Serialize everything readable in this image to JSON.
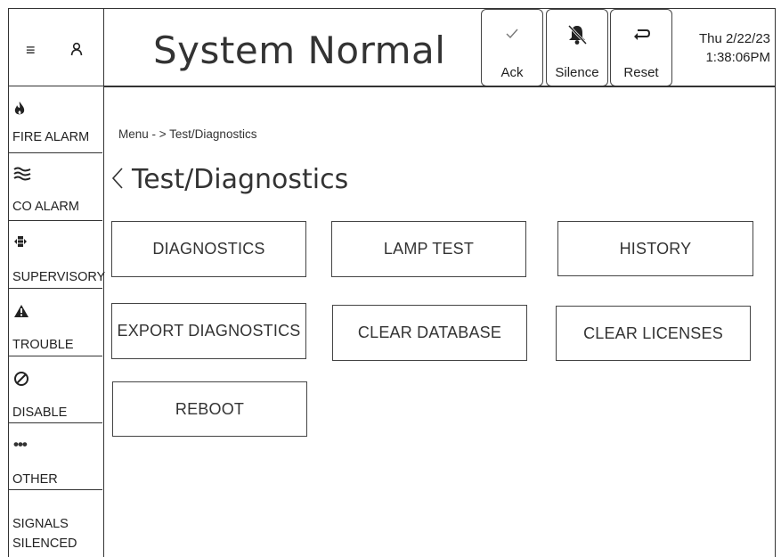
{
  "header": {
    "menu_icon": "hamburger-icon",
    "user_icon": "user-icon",
    "title": "System Normal",
    "buttons": [
      {
        "label": "Ack",
        "icon": "check-icon"
      },
      {
        "label": "Silence",
        "icon": "bell-muted-icon"
      },
      {
        "label": "Reset",
        "icon": "reset-arrow-icon"
      }
    ],
    "date": "Thu 2/22/23",
    "time": "1:38:06PM"
  },
  "sidebar": {
    "items": [
      {
        "label": "FIRE ALARM",
        "icon": "flame-icon"
      },
      {
        "label": "CO ALARM",
        "icon": "waves-icon"
      },
      {
        "label": "SUPERVISORY",
        "icon": "supervisory-icon"
      },
      {
        "label": "TROUBLE",
        "icon": "warning-icon"
      },
      {
        "label": "DISABLE",
        "icon": "prohibited-icon"
      },
      {
        "label": "OTHER",
        "icon": "more-icon"
      },
      {
        "label": "SIGNALS SILENCED"
      }
    ]
  },
  "main": {
    "breadcrumb": "Menu  - > Test/Diagnostics",
    "back_glyph": "〈",
    "page_title": "Test/Diagnostics",
    "tiles": [
      "DIAGNOSTICS",
      "LAMP TEST",
      "HISTORY",
      "EXPORT DIAGNOSTICS",
      "CLEAR DATABASE",
      "CLEAR LICENSES",
      "REBOOT"
    ]
  }
}
